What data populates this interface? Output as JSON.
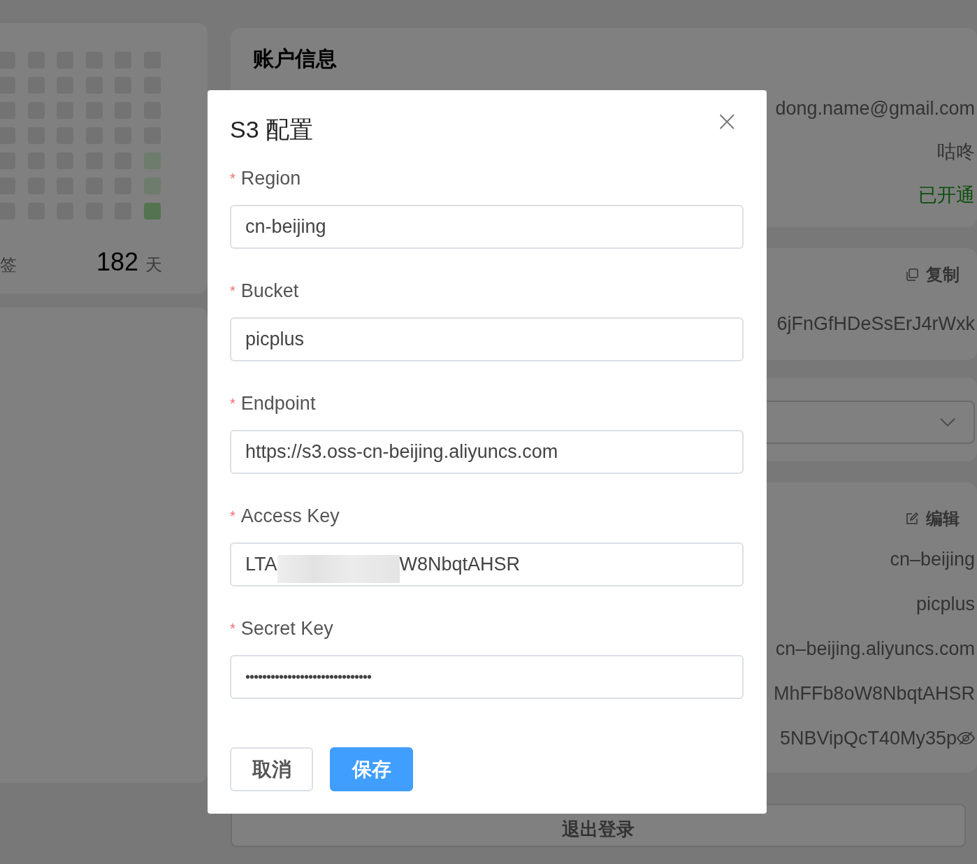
{
  "left_card": {
    "heatmap": [
      [
        {
          "color": "#737373"
        },
        {
          "color": "#737373"
        },
        {
          "color": "#737373"
        },
        {
          "color": "#737373"
        },
        {
          "color": "#737373"
        },
        {
          "color": "#737373"
        }
      ],
      [
        {
          "color": "#737373"
        },
        {
          "color": "#737373"
        },
        {
          "color": "#737373"
        },
        {
          "color": "#737373"
        },
        {
          "color": "#737373"
        },
        {
          "color": "#737373"
        }
      ],
      [
        {
          "color": "#737373"
        },
        {
          "color": "#737373"
        },
        {
          "color": "#737373"
        },
        {
          "color": "#737373"
        },
        {
          "color": "#737373"
        },
        {
          "color": "#737373"
        }
      ],
      [
        {
          "color": "#737373"
        },
        {
          "color": "#737373"
        },
        {
          "color": "#737373"
        },
        {
          "color": "#737373"
        },
        {
          "color": "#737373"
        },
        {
          "color": "#737373"
        }
      ],
      [
        {
          "color": "#737373"
        },
        {
          "color": "#737373"
        },
        {
          "color": "#737373"
        },
        {
          "color": "#737373"
        },
        {
          "color": "#737373"
        },
        {
          "color": "#6e7c6e"
        }
      ],
      [
        {
          "color": "#737373"
        },
        {
          "color": "#737373"
        },
        {
          "color": "#737373"
        },
        {
          "color": "#737373"
        },
        {
          "color": "#737373"
        },
        {
          "color": "#6e7c6e"
        }
      ],
      [
        {
          "color": "#737373"
        },
        {
          "color": "#737373"
        },
        {
          "color": "#737373"
        },
        {
          "color": "#737373"
        },
        {
          "color": "#737373"
        },
        {
          "color": "#547350"
        }
      ]
    ],
    "label": "签",
    "count": "182",
    "unit": "天"
  },
  "account": {
    "title": "账户信息",
    "rows": [
      {
        "value": "dong.name@gmail.com",
        "kind": "text"
      },
      {
        "value": "咕咚",
        "kind": "text"
      },
      {
        "value": "已开通",
        "kind": "status"
      }
    ]
  },
  "token": {
    "copy_button": "复制",
    "value": "6jFnGfHDeSsErJ4rWxk"
  },
  "storage": {
    "edit_button": "编辑",
    "rows": [
      {
        "value": "cn–beijing",
        "secret": false
      },
      {
        "value": "picplus",
        "secret": false
      },
      {
        "value": "cn–beijing.aliyuncs.com",
        "secret": false
      },
      {
        "value": "MhFFb8oW8NbqtAHSR",
        "secret": false
      },
      {
        "value": "5NBVipQcT40My35p",
        "secret": true
      }
    ]
  },
  "logout_button": "退出登录",
  "dialog": {
    "title": "S3 配置",
    "close": "×",
    "fields": [
      {
        "marker": "*",
        "label": "Region",
        "kind": "text",
        "value": "cn-beijing"
      },
      {
        "marker": "*",
        "label": "Bucket",
        "kind": "text",
        "value": "picplus"
      },
      {
        "marker": "*",
        "label": "Endpoint",
        "kind": "text",
        "value": "https://s3.oss-cn-beijing.aliyuncs.com"
      },
      {
        "marker": "*",
        "label": "Access Key",
        "kind": "redacted",
        "parts": [
          "LTA",
          "W8NbqtAHSR"
        ]
      },
      {
        "marker": "*",
        "label": "Secret Key",
        "kind": "password",
        "value": "••••••••••••••••••••••••••••••"
      }
    ],
    "buttons": [
      {
        "label": "取消",
        "kind": "default"
      },
      {
        "label": "保存",
        "kind": "primary"
      }
    ]
  }
}
